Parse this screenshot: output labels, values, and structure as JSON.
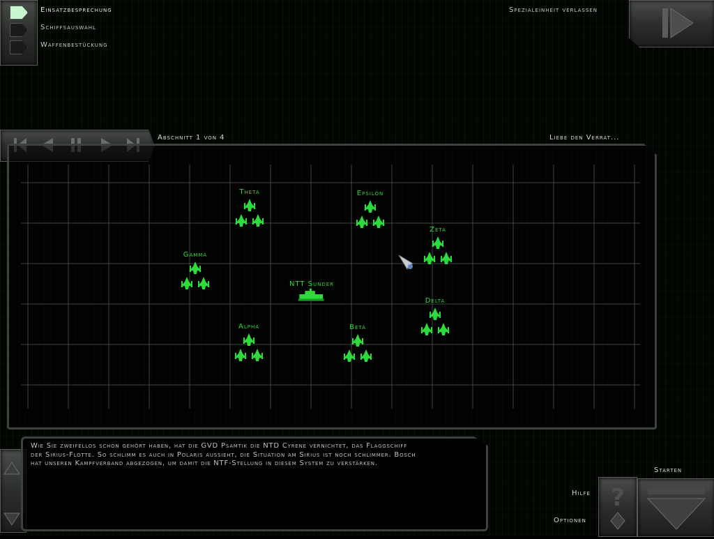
{
  "menu": {
    "items": [
      {
        "label": "Einsatzbesprechung",
        "active": true
      },
      {
        "label": "Schiffsauswahl",
        "active": false
      },
      {
        "label": "Waffenbestückung",
        "active": false
      }
    ]
  },
  "exit": {
    "label": "Spezialeinheit verlassen"
  },
  "briefing": {
    "stage_label": "Abschnitt 1 von 4",
    "stage_title": "Liebe den Verrat...",
    "text": "Wie Sie zweifellos schon gehört haben, hat die GVD Psamtik die NTD Cyrene vernichtet, das Flaggschiff der Sirius-Flotte. So schlimm es auch in Polaris aussieht, die Situation am Sirius ist noch schlimmer. Bosch hat unseren Kampfverband abgezogen, um damit die NTF-Stellung in diesem System zu verstärken."
  },
  "map": {
    "units": [
      {
        "label": "Theta"
      },
      {
        "label": "Epsilon"
      },
      {
        "label": "Zeta"
      },
      {
        "label": "Gamma"
      },
      {
        "label": "NTT Sunder"
      },
      {
        "label": "Delta"
      },
      {
        "label": "Alpha"
      },
      {
        "label": "Beta"
      }
    ]
  },
  "controls": {
    "start_label": "Starten",
    "help_label": "Hilfe",
    "options_label": "Optionen"
  },
  "colors": {
    "unit_green": "#2edb3d",
    "active_tab": "#c7f6cf",
    "panel_metal": "#3e423e"
  },
  "icons": [
    "rewind-start-icon",
    "rewind-icon",
    "pause-icon",
    "play-icon",
    "fast-forward-end-icon",
    "exit-arrow-icon",
    "help-icon",
    "start-arrow-icon",
    "scroll-up-icon",
    "scroll-down-icon"
  ]
}
